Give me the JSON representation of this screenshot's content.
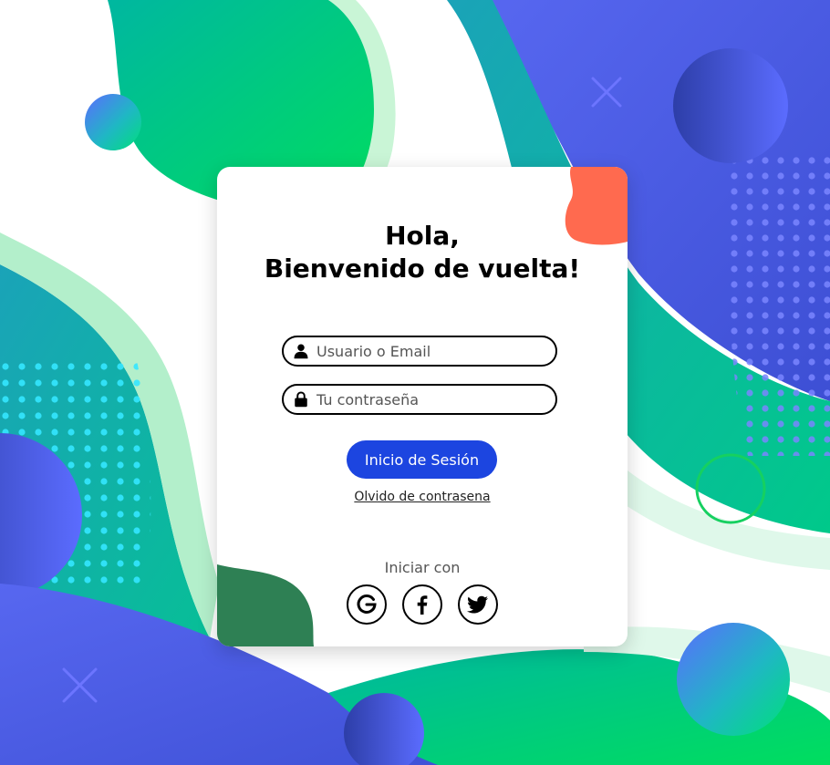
{
  "greeting": {
    "line1": "Hola,",
    "line2": "Bienvenido de vuelta!"
  },
  "form": {
    "username_placeholder": "Usuario o Email",
    "password_placeholder": "Tu contraseña",
    "username_icon": "user-icon",
    "password_icon": "lock-icon",
    "submit_label": "Inicio de Sesión",
    "forgot_label": "Olvido de contrasena"
  },
  "social": {
    "title": "Iniciar con",
    "providers": [
      "google-icon",
      "facebook-icon",
      "twitter-icon"
    ]
  },
  "colors": {
    "primary_button": "#1c45e0",
    "accent_coral": "#ff6a4f",
    "accent_dark_green": "#2e8054",
    "bg_green": "#00d468",
    "bg_teal": "#00a8a8",
    "bg_blue": "#4a5ce8"
  }
}
